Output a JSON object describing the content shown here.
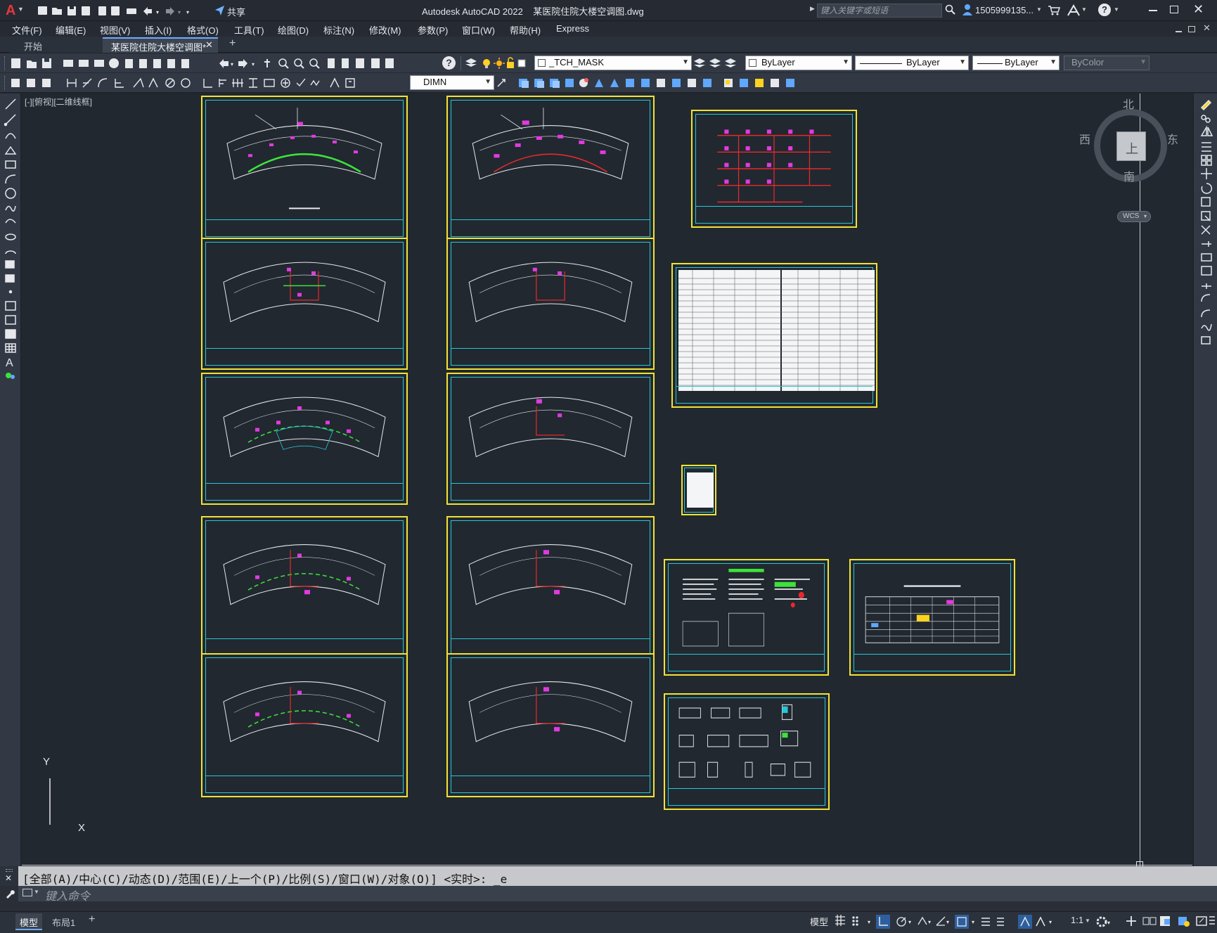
{
  "app": {
    "title": "Autodesk AutoCAD 2022    某医院住院大楼空调图.dwg",
    "share_label": "共享",
    "search_placeholder": "键入关键字或短语",
    "user": "1505999135...",
    "accent": "#e6373c"
  },
  "menu": [
    "文件(F)",
    "编辑(E)",
    "视图(V)",
    "插入(I)",
    "格式(O)",
    "工具(T)",
    "绘图(D)",
    "标注(N)",
    "修改(M)",
    "参数(P)",
    "窗口(W)",
    "帮助(H)",
    "Express"
  ],
  "tabs": [
    {
      "label": "开始",
      "active": false
    },
    {
      "label": "某医院住院大楼空调图*",
      "active": true
    }
  ],
  "toolbar": {
    "layer": "_TCH_MASK",
    "color": "ByLayer",
    "linetype": "ByLayer",
    "lineweight": "ByLayer",
    "plotstyle": "ByColor",
    "dimstyle": "DIMN"
  },
  "viewport_label": "[-][俯视][二维线框]",
  "viewcube": {
    "north": "北",
    "south": "南",
    "east": "东",
    "west": "西",
    "top": "上",
    "wcs": "WCS"
  },
  "ucs": {
    "x": "X",
    "y": "Y"
  },
  "command": {
    "history": "[全部(A)/中心(C)/动态(D)/范围(E)/上一个(P)/比例(S)/窗口(W)/对象(O)] <实时>: _e",
    "placeholder": "键入命令"
  },
  "layout_tabs": [
    "模型",
    "布局1"
  ],
  "status": {
    "model": "模型",
    "scale": "1:1"
  },
  "colors": {
    "sheet_border": "#f2e233",
    "frame": "#29c6d6",
    "green": "#3de23a",
    "magenta": "#e23ae0",
    "red": "#e8292b"
  }
}
